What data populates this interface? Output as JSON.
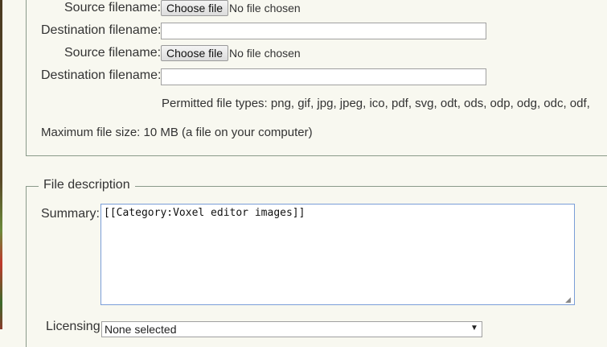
{
  "upload": {
    "rows": [
      {
        "source_label": "Source filename:",
        "button_label": "Choose file",
        "status": "No file chosen",
        "dest_label": "Destination filename:",
        "dest_value": ""
      },
      {
        "source_label": "Source filename:",
        "button_label": "Choose file",
        "status": "No file chosen",
        "dest_label": "Destination filename:",
        "dest_value": ""
      }
    ],
    "permitted_types": "Permitted file types: png, gif, jpg, jpeg, ico, pdf, svg, odt, ods, odp, odg, odc, odf,",
    "max_size": "Maximum file size: 10 MB (a file on your computer)"
  },
  "description": {
    "legend": "File description",
    "summary_label": "Summary:",
    "summary_value": "[[Category:Voxel editor images]]",
    "licensing_label": "Licensing:",
    "licensing_value": "None selected"
  }
}
